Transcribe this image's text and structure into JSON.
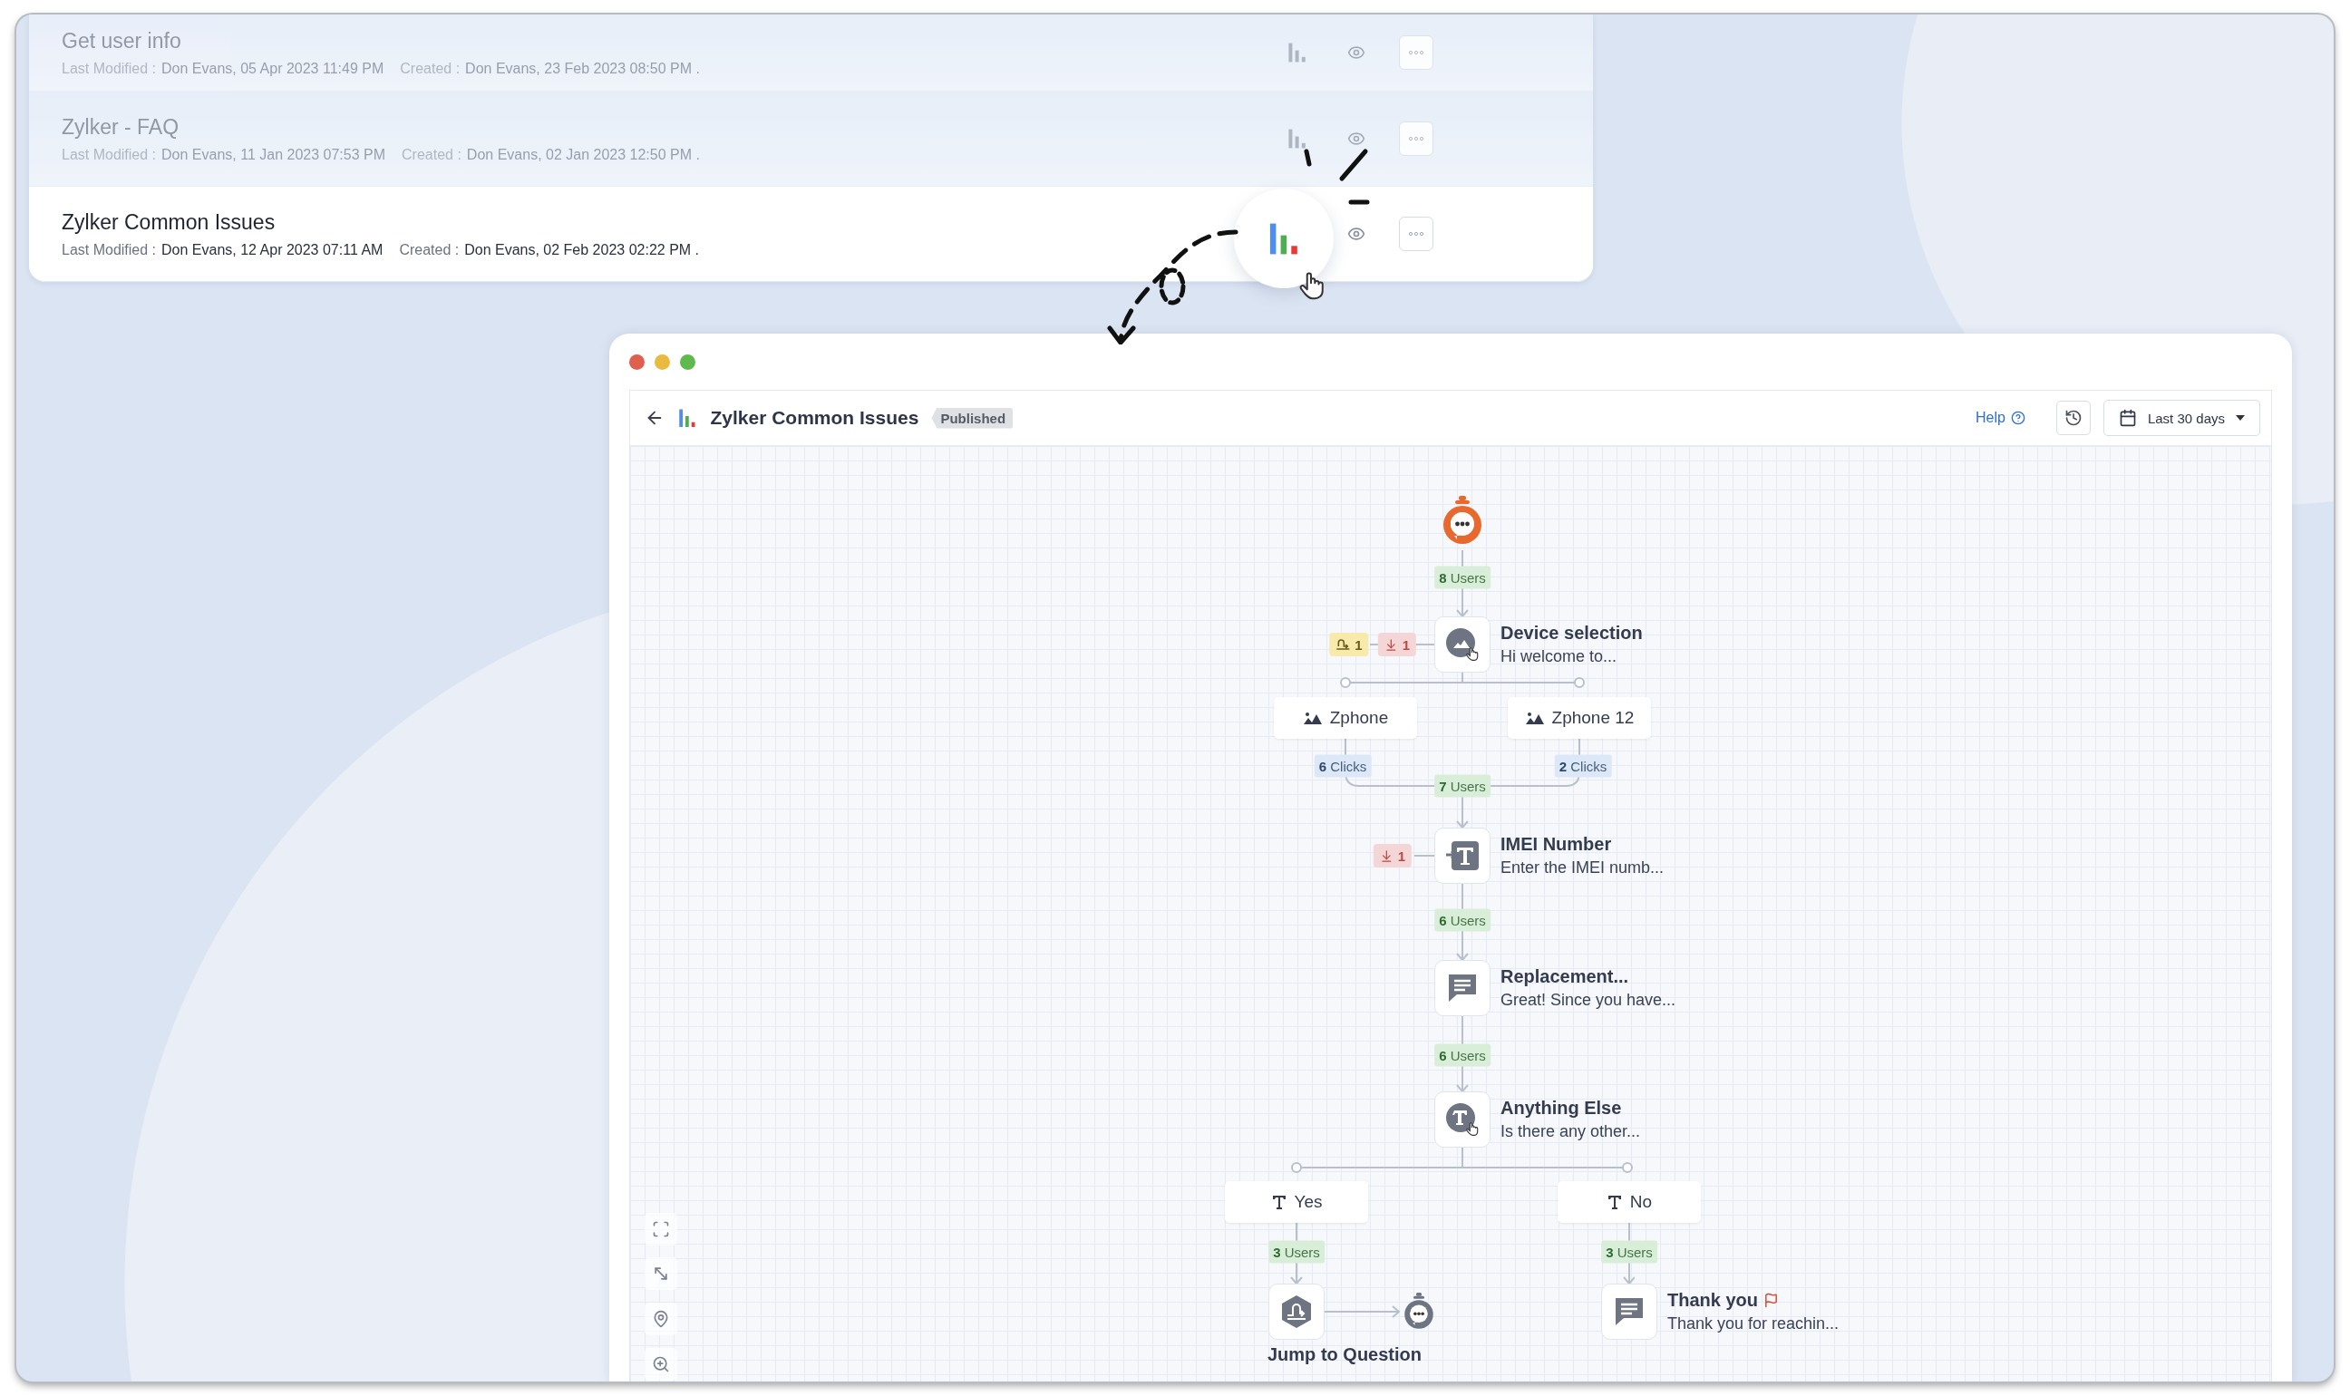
{
  "reports": [
    {
      "title": "Get user info",
      "modified_label": "Last Modified :",
      "modified": "Don Evans, 05 Apr 2023 11:49 PM",
      "created_label": "Created :",
      "created": "Don Evans, 23 Feb 2023 08:50 PM .",
      "dimmed": true,
      "selected": false
    },
    {
      "title": "Zylker - FAQ",
      "modified_label": "Last Modified :",
      "modified": "Don Evans, 11 Jan 2023 07:53 PM",
      "created_label": "Created :",
      "created": "Don Evans, 02 Jan 2023 12:50 PM .",
      "dimmed": true,
      "selected": false
    },
    {
      "title": "Zylker Common Issues",
      "modified_label": "Last Modified :",
      "modified": "Don Evans, 12 Apr 2023 07:11 AM",
      "created_label": "Created :",
      "created": "Don Evans, 02 Feb 2023 02:22 PM .",
      "dimmed": false,
      "selected": true
    }
  ],
  "window": {
    "title": "Zylker Common Issues",
    "status": "Published",
    "help": "Help",
    "date_range": "Last 30 days"
  },
  "flow": {
    "counts": [
      {
        "text": "**8** Users"
      },
      {
        "text": "**7** Users"
      },
      {
        "text": "**6** Users"
      },
      {
        "text": "**6** Users"
      },
      {
        "text": "**3** Users"
      },
      {
        "text": "**3** Users"
      }
    ],
    "clicks": [
      {
        "text": "**6** Clicks"
      },
      {
        "text": "**2** Clicks"
      }
    ],
    "nodes": [
      {
        "kind": "image_choice",
        "title": "Device selection",
        "preview": "Hi welcome to...",
        "end": false
      },
      {
        "kind": "text_input",
        "title": "IMEI Number",
        "preview": "Enter the IMEI numb...",
        "end": false
      },
      {
        "kind": "message",
        "title": "Replacement...",
        "preview": "Great! Since you have...",
        "end": false
      },
      {
        "kind": "text_choice",
        "title": "Anything Else",
        "preview": "Is there any other...",
        "end": false
      },
      {
        "kind": "jump",
        "title": "Jump to Question",
        "end": false
      },
      {
        "kind": "message",
        "title": "Thank you",
        "preview": "Thank you for reachin...",
        "end": true
      }
    ],
    "options": [
      {
        "kind": "image",
        "label": "Zphone"
      },
      {
        "kind": "image",
        "label": "Zphone 12"
      },
      {
        "kind": "text",
        "label": "Yes"
      },
      {
        "kind": "text",
        "label": "No"
      }
    ],
    "stats": [
      {
        "kind": "skipped",
        "value": "1"
      },
      {
        "kind": "dropped",
        "value": "1"
      },
      {
        "kind": "dropped",
        "value": "1"
      }
    ]
  }
}
